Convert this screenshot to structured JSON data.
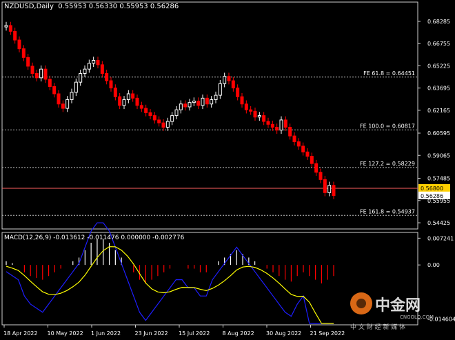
{
  "header": {
    "symbol": "NZDUSD,Daily",
    "ohlc": "0.55953 0.56330 0.55953 0.56286"
  },
  "price_axis": {
    "ticks": [
      "0.68285",
      "0.66755",
      "0.65225",
      "0.63695",
      "0.62165",
      "0.60595",
      "0.59065",
      "0.57485",
      "0.55955",
      "0.54425"
    ],
    "tick_values": [
      0.68285,
      0.66755,
      0.65225,
      0.63695,
      0.62165,
      0.60595,
      0.59065,
      0.57485,
      0.55955,
      0.54425
    ],
    "hline_label": "0.56800",
    "hline_value": 0.568,
    "last_label": "0.56286",
    "last_value": 0.56286
  },
  "fib_levels": [
    {
      "label": "FE 61.8 = 0.64451",
      "value": 0.64451
    },
    {
      "label": "FE 100.0 = 0.60817",
      "value": 0.60817
    },
    {
      "label": "FE 127.2 = 0.58229",
      "value": 0.58229
    },
    {
      "label": "FE 161.8 = 0.54937",
      "value": 0.54937
    }
  ],
  "macd": {
    "title": "MACD(12,26,9) -0.013612 -0.011476 0.000000 -0.002776",
    "ticks": [
      "0.007241",
      "0.00",
      "-0.014604"
    ],
    "tick_values": [
      0.007241,
      0.0,
      -0.014604
    ]
  },
  "date_axis": {
    "labels": [
      "18 Apr 2022",
      "10 May 2022",
      "1 Jun 2022",
      "23 Jun 2022",
      "15 Jul 2022",
      "8 Aug 2022",
      "30 Aug 2022",
      "21 Sep 2022"
    ]
  },
  "watermark": {
    "brand": "中金网",
    "url": "CNGOLD.COM",
    "slogan": "中 文 财 经 新 媒 体"
  },
  "colors": {
    "bull": "#ffffff",
    "bear": "#ff0000",
    "signal": "#ffff00",
    "macd_line": "#1e1eff",
    "hline": "#ff6060",
    "hline_bg": "#ffd000"
  },
  "chart_data": {
    "type": "candlestick",
    "closes": [
      0.68,
      0.676,
      0.67,
      0.664,
      0.658,
      0.652,
      0.647,
      0.644,
      0.65,
      0.643,
      0.638,
      0.633,
      0.626,
      0.623,
      0.629,
      0.634,
      0.641,
      0.647,
      0.65,
      0.654,
      0.656,
      0.653,
      0.647,
      0.642,
      0.637,
      0.631,
      0.625,
      0.629,
      0.633,
      0.63,
      0.625,
      0.623,
      0.62,
      0.618,
      0.615,
      0.613,
      0.61,
      0.614,
      0.618,
      0.622,
      0.626,
      0.624,
      0.627,
      0.628,
      0.625,
      0.63,
      0.626,
      0.629,
      0.632,
      0.64,
      0.645,
      0.642,
      0.637,
      0.631,
      0.626,
      0.622,
      0.621,
      0.617,
      0.618,
      0.614,
      0.612,
      0.61,
      0.608,
      0.615,
      0.61,
      0.604,
      0.6,
      0.597,
      0.593,
      0.59,
      0.585,
      0.579,
      0.574,
      0.565,
      0.57,
      0.563
    ],
    "macd_hist": [
      0.001,
      0.0005,
      0.0,
      -0.002,
      -0.003,
      -0.0035,
      -0.004,
      -0.003,
      -0.002,
      -0.001,
      0.0,
      0.001,
      0.002,
      0.004,
      0.006,
      0.007,
      0.007,
      0.006,
      0.004,
      0.002,
      0.0,
      -0.002,
      -0.004,
      -0.005,
      -0.004,
      -0.003,
      -0.002,
      -0.001,
      0.0,
      0.0,
      -0.001,
      -0.001,
      -0.002,
      -0.002,
      0.0,
      0.001,
      0.002,
      0.003,
      0.004,
      0.003,
      0.002,
      0.001,
      0.0,
      -0.001,
      -0.002,
      -0.003,
      -0.004,
      -0.0045,
      -0.003,
      -0.002,
      -0.003,
      -0.004,
      -0.005,
      -0.004,
      -0.003
    ]
  }
}
